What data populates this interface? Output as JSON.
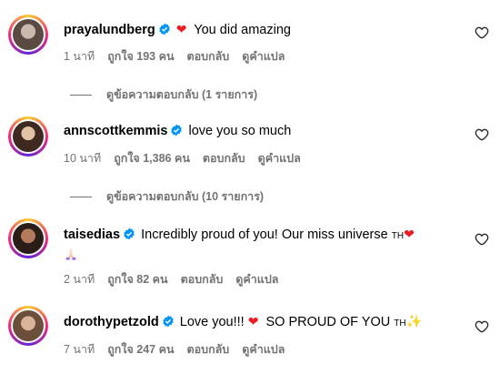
{
  "comments": [
    {
      "username": "prayalundberg",
      "text": "You did amazing",
      "text_prefix_emoji": "heart",
      "time": "1 นาที",
      "likes": "ถูกใจ 193 คน",
      "reply": "ตอบกลับ",
      "translate": "ดูคำแปล",
      "view_replies": "ดูข้อความตอบกลับ (1 รายการ)"
    },
    {
      "username": "annscottkemmis",
      "text": "love you so much",
      "time": "10 นาที",
      "likes": "ถูกใจ 1,386 คน",
      "reply": "ตอบกลับ",
      "translate": "ดูคำแปล",
      "view_replies": "ดูข้อความตอบกลับ (10 รายการ)"
    },
    {
      "username": "taisedias",
      "text": "Incredibly proud of you! Our miss universe",
      "text_suffix": "TH",
      "time": "2 นาที",
      "likes": "ถูกใจ 82 คน",
      "reply": "ตอบกลับ",
      "translate": "ดูคำแปล"
    },
    {
      "username": "dorothypetzold",
      "text": "Love you!!!",
      "text_2": "SO PROUD OF YOU",
      "text_suffix": "TH",
      "time": "7 นาที",
      "likes": "ถูกใจ 247 คน",
      "reply": "ตอบกลับ",
      "translate": "ดูคำแปล"
    }
  ],
  "icons": {
    "verified": "verified-badge-icon",
    "like": "heart-outline-icon",
    "praying_hands": "praying-hands-emoji",
    "sparkles": "sparkles-emoji"
  },
  "colors": {
    "verified_blue": "#0095f6",
    "meta_gray": "#737373",
    "heart_red": "#ed1c24"
  }
}
